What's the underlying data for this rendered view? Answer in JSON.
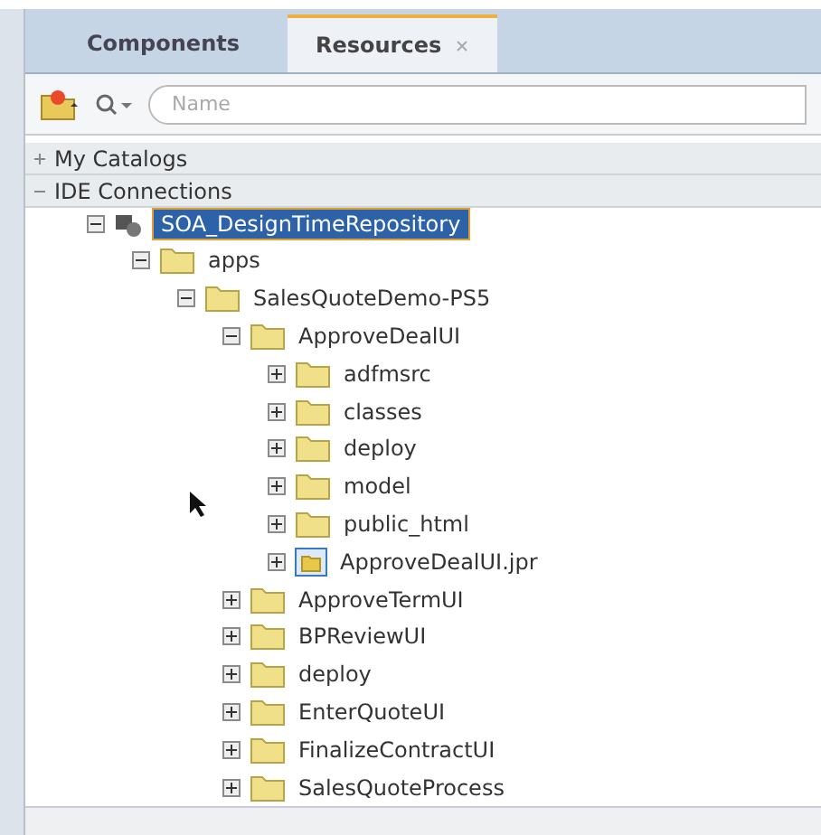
{
  "tabs": [
    {
      "label": "Components",
      "selected": false,
      "closable": false
    },
    {
      "label": "Resources",
      "selected": true,
      "closable": true
    }
  ],
  "search": {
    "placeholder": "Name"
  },
  "sections": [
    {
      "label": "My Catalogs",
      "expanded": false
    },
    {
      "label": "IDE Connections",
      "expanded": true
    }
  ],
  "tree": [
    {
      "label": "SOA_DesignTimeRepository",
      "kind": "connection",
      "expanded": true,
      "selected": true,
      "children": [
        {
          "label": "apps",
          "kind": "folder",
          "expanded": true,
          "selected": false,
          "children": [
            {
              "label": "SalesQuoteDemo-PS5",
              "kind": "folder",
              "expanded": true,
              "selected": false,
              "children": [
                {
                  "label": "ApproveDealUI",
                  "kind": "folder",
                  "expanded": true,
                  "selected": false,
                  "children": [
                    {
                      "label": "adfmsrc",
                      "kind": "folder",
                      "expanded": false,
                      "selected": false
                    },
                    {
                      "label": "classes",
                      "kind": "folder",
                      "expanded": false,
                      "selected": false
                    },
                    {
                      "label": "deploy",
                      "kind": "folder",
                      "expanded": false,
                      "selected": false
                    },
                    {
                      "label": "model",
                      "kind": "folder",
                      "expanded": false,
                      "selected": false
                    },
                    {
                      "label": "public_html",
                      "kind": "folder",
                      "expanded": false,
                      "selected": false
                    },
                    {
                      "label": "ApproveDealUI.jpr",
                      "kind": "project",
                      "expanded": false,
                      "selected": false
                    }
                  ]
                },
                {
                  "label": "ApproveTermUI",
                  "kind": "folder",
                  "expanded": false,
                  "selected": false
                },
                {
                  "label": "BPReviewUI",
                  "kind": "folder",
                  "expanded": false,
                  "selected": false
                },
                {
                  "label": "deploy",
                  "kind": "folder",
                  "expanded": false,
                  "selected": false
                },
                {
                  "label": "EnterQuoteUI",
                  "kind": "folder",
                  "expanded": false,
                  "selected": false
                },
                {
                  "label": "FinalizeContractUI",
                  "kind": "folder",
                  "expanded": false,
                  "selected": false
                },
                {
                  "label": "SalesQuoteProcess",
                  "kind": "folder",
                  "expanded": false,
                  "selected": false
                }
              ]
            }
          ]
        }
      ]
    }
  ]
}
